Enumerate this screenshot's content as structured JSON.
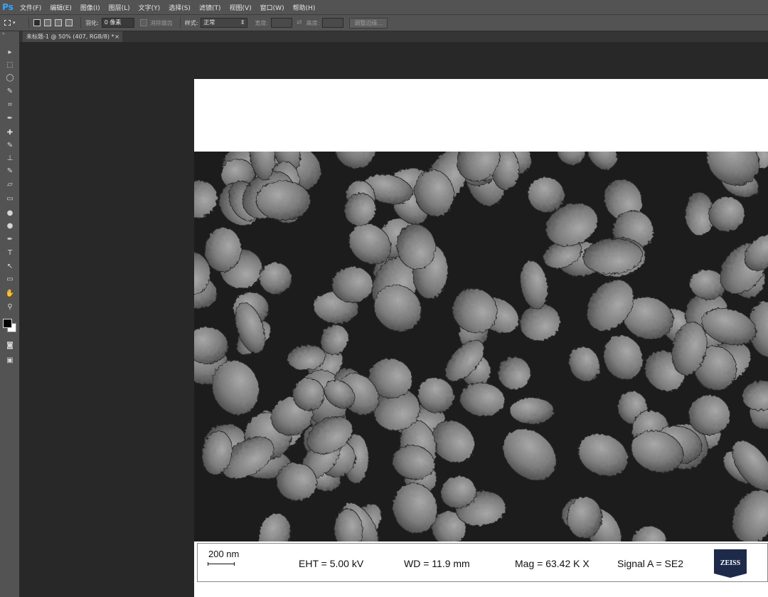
{
  "app": {
    "logo": "Ps"
  },
  "menu": [
    "文件(F)",
    "编辑(E)",
    "图像(I)",
    "图层(L)",
    "文字(Y)",
    "选择(S)",
    "滤镜(T)",
    "视图(V)",
    "窗口(W)",
    "帮助(H)"
  ],
  "options": {
    "feather_label": "羽化:",
    "feather_value": "0 像素",
    "antialias_label": "消除锯齿",
    "style_label": "样式:",
    "style_value": "正常",
    "width_label": "宽度:",
    "height_label": "高度:",
    "refine_edge_button": "调整边缘..."
  },
  "document_tab": {
    "title": "未标题-1 @ 50% (407, RGB/8) *",
    "close": "×"
  },
  "tools": [
    "move-icon",
    "marquee-icon",
    "lasso-icon",
    "quick-select-icon",
    "crop-icon",
    "eyedropper-icon",
    "healing-brush-icon",
    "brush-icon",
    "clone-stamp-icon",
    "history-brush-icon",
    "eraser-icon",
    "gradient-icon",
    "blur-icon",
    "dodge-icon",
    "pen-icon",
    "type-icon",
    "path-select-icon",
    "shape-icon",
    "hand-icon",
    "zoom-icon"
  ],
  "tool_glyphs": [
    "▸",
    "⬚",
    "◯",
    "✎",
    "⌗",
    "✒",
    "✚",
    "✎",
    "⊥",
    "✎",
    "▱",
    "▭",
    "●",
    "●",
    "✒",
    "T",
    "↖",
    "▭",
    "✋",
    "⚲"
  ],
  "sem": {
    "scale_label": "200 nm",
    "eht": "EHT =  5.00 kV",
    "wd": "WD = 11.9 mm",
    "mag": "Mag =   63.42 K X",
    "signal": "Signal A = SE2",
    "logo_text": "ZEISS"
  }
}
